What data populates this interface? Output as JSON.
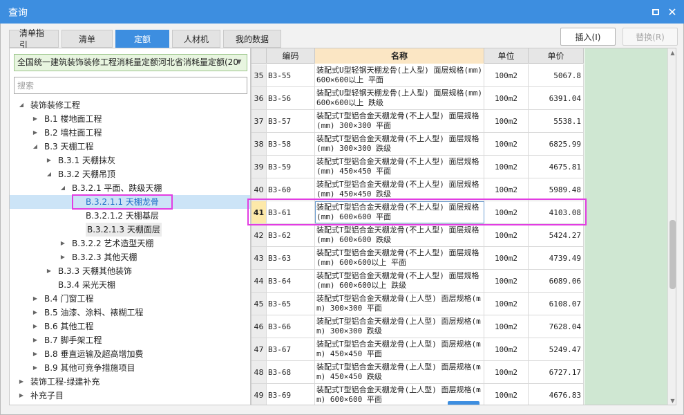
{
  "window": {
    "title": "查询"
  },
  "tabs": [
    "清单指引",
    "清单",
    "定额",
    "人材机",
    "我的数据"
  ],
  "active_tab": 2,
  "buttons": {
    "insert": "插入(I)",
    "replace": "替换(R)"
  },
  "library": {
    "selected": "全国统一建筑装饰装修工程消耗量定额河北省消耗量定额(20"
  },
  "search": {
    "placeholder": "搜索"
  },
  "tree": [
    {
      "label": "装饰装修工程",
      "level": 0,
      "state": "expanded"
    },
    {
      "label": "B.1 楼地面工程",
      "level": 1,
      "state": "collapsed"
    },
    {
      "label": "B.2 墙柱面工程",
      "level": 1,
      "state": "collapsed"
    },
    {
      "label": "B.3 天棚工程",
      "level": 1,
      "state": "expanded"
    },
    {
      "label": "B.3.1 天棚抹灰",
      "level": 2,
      "state": "collapsed"
    },
    {
      "label": "B.3.2 天棚吊顶",
      "level": 2,
      "state": "expanded"
    },
    {
      "label": "B.3.2.1 平面、跌级天棚",
      "level": 3,
      "state": "expanded"
    },
    {
      "label": "B.3.2.1.1 天棚龙骨",
      "level": 4,
      "state": "leaf",
      "selected": true
    },
    {
      "label": "B.3.2.1.2 天棚基层",
      "level": 4,
      "state": "leaf"
    },
    {
      "label": "B.3.2.1.3 天棚面层",
      "level": 4,
      "state": "leaf",
      "grey": true
    },
    {
      "label": "B.3.2.2 艺术造型天棚",
      "level": 3,
      "state": "collapsed"
    },
    {
      "label": "B.3.2.3 其他天棚",
      "level": 3,
      "state": "collapsed"
    },
    {
      "label": "B.3.3 天棚其他装饰",
      "level": 2,
      "state": "collapsed"
    },
    {
      "label": "B.3.4 采光天棚",
      "level": 2,
      "state": "leaf"
    },
    {
      "label": "B.4 门窗工程",
      "level": 1,
      "state": "collapsed"
    },
    {
      "label": "B.5 油漆、涂料、裱糊工程",
      "level": 1,
      "state": "collapsed"
    },
    {
      "label": "B.6 其他工程",
      "level": 1,
      "state": "collapsed"
    },
    {
      "label": "B.7 脚手架工程",
      "level": 1,
      "state": "collapsed"
    },
    {
      "label": "B.8 垂直运输及超高增加费",
      "level": 1,
      "state": "collapsed"
    },
    {
      "label": "B.9 其他可竞争措施项目",
      "level": 1,
      "state": "collapsed"
    },
    {
      "label": "装饰工程-绿建补充",
      "level": 0,
      "state": "collapsed"
    },
    {
      "label": "补充子目",
      "level": 0,
      "state": "collapsed"
    }
  ],
  "table": {
    "columns": [
      "",
      "编码",
      "名称",
      "单位",
      "单价"
    ],
    "current_row": "41",
    "rows": [
      {
        "no": "35",
        "code": "B3-55",
        "name": "装配式U型轻钢天棚龙骨(上人型) 面层规格(mm) 600×600以上 平面",
        "unit": "100m2",
        "price": "5067.8"
      },
      {
        "no": "36",
        "code": "B3-56",
        "name": "装配式U型轻钢天棚龙骨(上人型) 面层规格(mm) 600×600以上 跌级",
        "unit": "100m2",
        "price": "6391.04"
      },
      {
        "no": "37",
        "code": "B3-57",
        "name": "装配式T型铝合金天棚龙骨(不上人型) 面层规格(mm) 300×300 平面",
        "unit": "100m2",
        "price": "5538.1"
      },
      {
        "no": "38",
        "code": "B3-58",
        "name": "装配式T型铝合金天棚龙骨(不上人型) 面层规格(mm) 300×300 跌级",
        "unit": "100m2",
        "price": "6825.99"
      },
      {
        "no": "39",
        "code": "B3-59",
        "name": "装配式T型铝合金天棚龙骨(不上人型) 面层规格(mm) 450×450 平面",
        "unit": "100m2",
        "price": "4675.81"
      },
      {
        "no": "40",
        "code": "B3-60",
        "name": "装配式T型铝合金天棚龙骨(不上人型) 面层规格(mm) 450×450 跌级",
        "unit": "100m2",
        "price": "5989.48"
      },
      {
        "no": "41",
        "code": "B3-61",
        "name": "装配式T型铝合金天棚龙骨(不上人型) 面层规格(mm) 600×600 平面",
        "unit": "100m2",
        "price": "4103.08"
      },
      {
        "no": "42",
        "code": "B3-62",
        "name": "装配式T型铝合金天棚龙骨(不上人型) 面层规格(mm) 600×600 跌级",
        "unit": "100m2",
        "price": "5424.27"
      },
      {
        "no": "43",
        "code": "B3-63",
        "name": "装配式T型铝合金天棚龙骨(不上人型) 面层规格(mm) 600×600以上 平面",
        "unit": "100m2",
        "price": "4739.49"
      },
      {
        "no": "44",
        "code": "B3-64",
        "name": "装配式T型铝合金天棚龙骨(不上人型) 面层规格(mm) 600×600以上 跌级",
        "unit": "100m2",
        "price": "6089.06"
      },
      {
        "no": "45",
        "code": "B3-65",
        "name": "装配式T型铝合金天棚龙骨(上人型) 面层规格(mm) 300×300 平面",
        "unit": "100m2",
        "price": "6108.07"
      },
      {
        "no": "46",
        "code": "B3-66",
        "name": "装配式T型铝合金天棚龙骨(上人型) 面层规格(mm) 300×300 跌级",
        "unit": "100m2",
        "price": "7628.04"
      },
      {
        "no": "47",
        "code": "B3-67",
        "name": "装配式T型铝合金天棚龙骨(上人型) 面层规格(mm) 450×450 平面",
        "unit": "100m2",
        "price": "5249.47"
      },
      {
        "no": "48",
        "code": "B3-68",
        "name": "装配式T型铝合金天棚龙骨(上人型) 面层规格(mm) 450×450 跌级",
        "unit": "100m2",
        "price": "6727.17"
      },
      {
        "no": "49",
        "code": "B3-69",
        "name": "装配式T型铝合金天棚龙骨(上人型) 面层规格(mm) 600×600 平面",
        "unit": "100m2",
        "price": "4676.83"
      }
    ]
  },
  "colors": {
    "accent": "#3d8ee0",
    "highlight": "#e23de2",
    "price_fill": "#cfe7d2",
    "combo_fill": "#e8f5e0",
    "name_header": "#fbe6c4"
  },
  "icons": {
    "restore": "restore-icon",
    "close": "close-icon",
    "dropdown": "chevron-down-icon",
    "expand": "triangle-right-icon",
    "collapse": "triangle-down-icon"
  }
}
